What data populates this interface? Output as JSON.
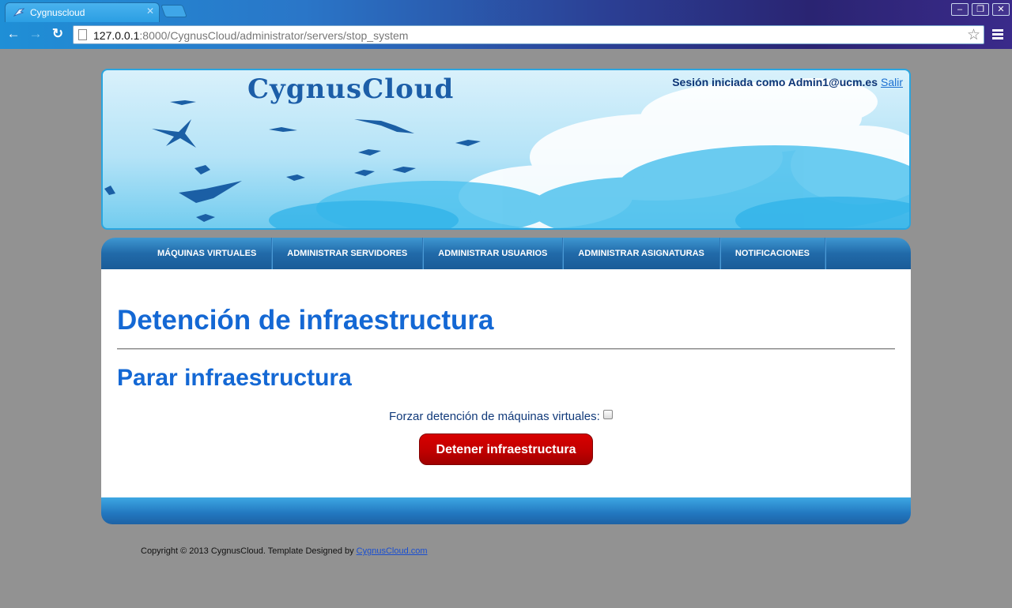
{
  "browser": {
    "tab_title": "Cygnuscloud",
    "url_host": "127.0.0.1",
    "url_rest": ":8000/CygnusCloud/administrator/servers/stop_system",
    "window_controls": [
      "–",
      "❐",
      "✕"
    ]
  },
  "header": {
    "logo": "CygnusCloud",
    "session_text": "Sesión iniciada como Admin1@ucm.es",
    "logout_link": "Salir"
  },
  "nav": {
    "items": [
      "MÁQUINAS VIRTUALES",
      "ADMINISTRAR SERVIDORES",
      "ADMINISTRAR USUARIOS",
      "ADMINISTRAR ASIGNATURAS",
      "NOTIFICACIONES"
    ]
  },
  "main": {
    "title": "Detención de infraestructura",
    "subtitle": "Parar infraestructura",
    "force_label": "Forzar detención de máquinas virtuales:",
    "force_checked": false,
    "submit_label": "Detener infraestructura"
  },
  "footer": {
    "copyright": "Copyright © 2013 CygnusCloud. Template Designed by ",
    "link": "CygnusCloud.com"
  },
  "colors": {
    "accent": "#1468d4",
    "nav": "#216aa9",
    "button": "#c10000"
  }
}
